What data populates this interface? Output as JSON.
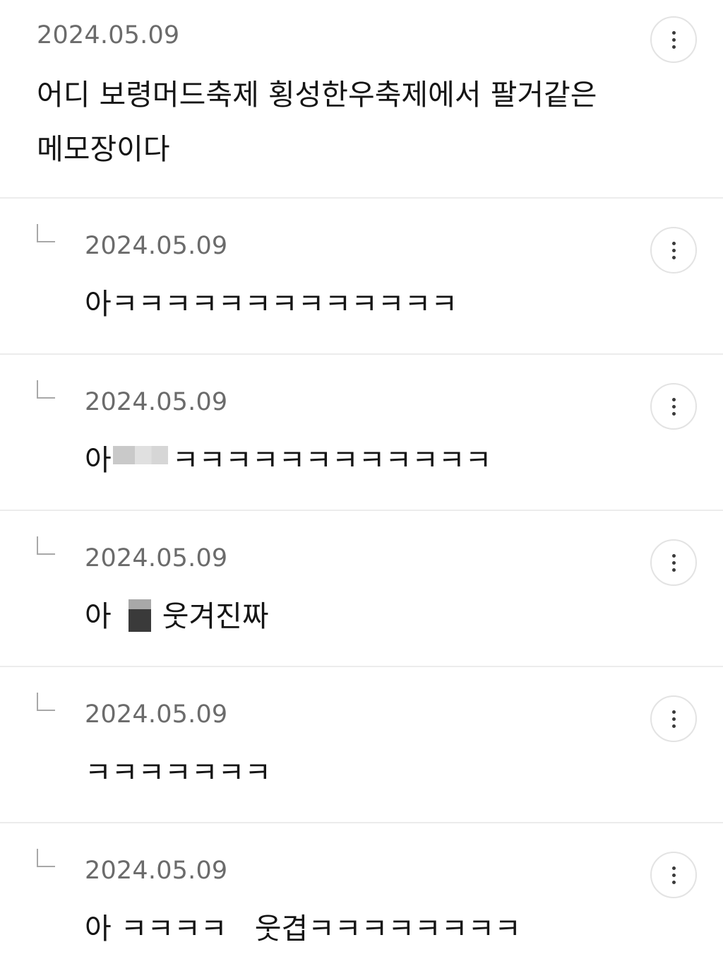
{
  "comments": [
    {
      "date": "2024.05.09",
      "text_line1": "어디 보령머드축제 횡성한우축제에서 팔거같은",
      "text_line2": "메모장이다"
    },
    {
      "date": "2024.05.09",
      "text": "아ㅋㅋㅋㅋㅋㅋㅋㅋㅋㅋㅋㅋㅋ"
    },
    {
      "date": "2024.05.09",
      "text_prefix": "아",
      "text_suffix": "ㅋㅋㅋㅋㅋㅋㅋㅋㅋㅋㅋㅋ"
    },
    {
      "date": "2024.05.09",
      "text_prefix": "아",
      "text_suffix": "웃겨진짜"
    },
    {
      "date": "2024.05.09",
      "text": "ㅋㅋㅋㅋㅋㅋㅋ"
    },
    {
      "date": "2024.05.09",
      "text": "아 ㅋㅋㅋㅋ   웃겹ㅋㅋㅋㅋㅋㅋㅋㅋ"
    }
  ],
  "icons": {
    "more": "more-vertical-icon",
    "reply": "reply-arrow-icon"
  },
  "colors": {
    "date": "#6b6b6b",
    "text": "#151515",
    "divider": "#ececec"
  }
}
